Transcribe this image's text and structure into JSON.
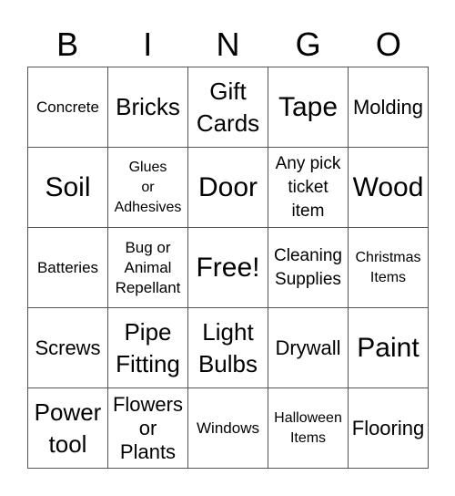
{
  "header": [
    "B",
    "I",
    "N",
    "G",
    "O"
  ],
  "cells": [
    {
      "text": "Concrete",
      "size": "xs"
    },
    {
      "text": "Bricks",
      "size": "ml"
    },
    {
      "text": "Gift\nCards",
      "size": "ml"
    },
    {
      "text": "Tape",
      "size": "l"
    },
    {
      "text": "Molding",
      "size": "m"
    },
    {
      "text": "Soil",
      "size": "l"
    },
    {
      "text": "Glues\nor\nAdhesives",
      "size": "xxs"
    },
    {
      "text": "Door",
      "size": "l"
    },
    {
      "text": "Any pick\nticket\nitem",
      "size": "s"
    },
    {
      "text": "Wood",
      "size": "l"
    },
    {
      "text": "Batteries",
      "size": "xs"
    },
    {
      "text": "Bug or\nAnimal\nRepellant",
      "size": "xs"
    },
    {
      "text": "Free!",
      "size": "l"
    },
    {
      "text": "Cleaning\nSupplies",
      "size": "s"
    },
    {
      "text": "Christmas\nItems",
      "size": "xxs"
    },
    {
      "text": "Screws",
      "size": "m"
    },
    {
      "text": "Pipe\nFitting",
      "size": "ml"
    },
    {
      "text": "Light\nBulbs",
      "size": "ml"
    },
    {
      "text": "Drywall",
      "size": "m"
    },
    {
      "text": "Paint",
      "size": "l"
    },
    {
      "text": "Power\ntool",
      "size": "ml"
    },
    {
      "text": "Flowers\nor\nPlants",
      "size": "m"
    },
    {
      "text": "Windows",
      "size": "xs"
    },
    {
      "text": "Halloween\nItems",
      "size": "xxs"
    },
    {
      "text": "Flooring",
      "size": "m"
    }
  ]
}
